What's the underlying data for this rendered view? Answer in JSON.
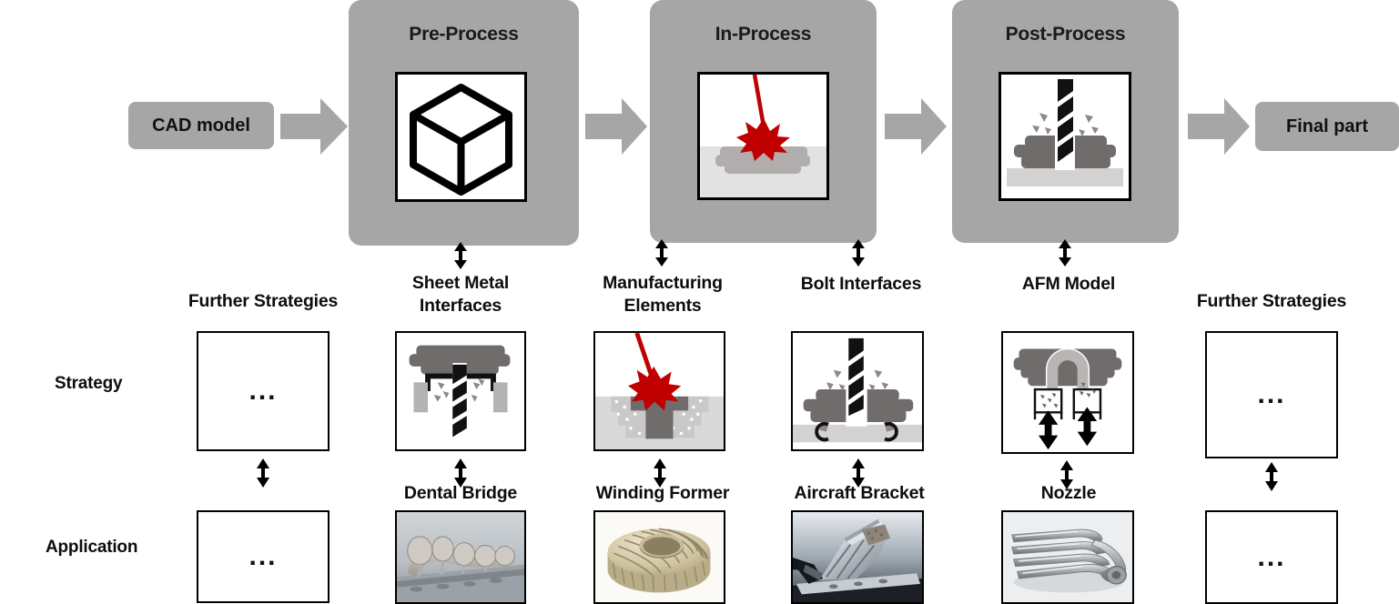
{
  "diagram": {
    "title": "Additive manufacturing process chain with strategies and applications",
    "colors": {
      "stage_gray": "#a6a6a6",
      "arrow_gray": "#a6a6a6",
      "laser_red": "#c00000",
      "part_dark_gray": "#706c6b",
      "powder_gray": "#d9d9d9",
      "black": "#000000"
    }
  },
  "chain": {
    "input_label": "CAD model",
    "output_label": "Final part",
    "stages": [
      {
        "title": "Pre-Process",
        "icon": "cube-icon"
      },
      {
        "title": "In-Process",
        "icon": "laser-melting-icon"
      },
      {
        "title": "Post-Process",
        "icon": "drilling-icon"
      }
    ],
    "arrows": [
      "arrow-right-icon",
      "arrow-right-icon",
      "arrow-right-icon",
      "arrow-right-icon"
    ]
  },
  "rows": {
    "strategy_label": "Strategy",
    "application_label": "Application"
  },
  "columns": [
    {
      "heading": "Further Strategies",
      "strategy_icon": "ellipsis-placeholder",
      "strategy_value": "...",
      "application_heading": "",
      "application_icon": "ellipsis-placeholder",
      "application_value": "...",
      "link_icon": "double-arrow-vertical-icon"
    },
    {
      "heading": "Sheet Metal\nInterfaces",
      "heading_line1": "Sheet Metal",
      "heading_line2": "Interfaces",
      "strategy_icon": "sheet-metal-drilling-icon",
      "application_heading": "Dental Bridge",
      "application_icon": "dental-bridge-photo",
      "link_icon": "double-arrow-vertical-icon"
    },
    {
      "heading": "Manufacturing\nElements",
      "heading_line1": "Manufacturing",
      "heading_line2": "Elements",
      "strategy_icon": "laser-melting-powder-icon",
      "application_heading": "Winding Former",
      "application_icon": "winding-former-photo",
      "link_icon": "double-arrow-vertical-icon"
    },
    {
      "heading": "Bolt Interfaces",
      "heading_line1": "Bolt Interfaces",
      "heading_line2": "",
      "strategy_icon": "bolt-drilling-icon",
      "application_heading": "Aircraft Bracket",
      "application_icon": "aircraft-bracket-photo",
      "link_icon": "double-arrow-vertical-icon"
    },
    {
      "heading": "AFM Model",
      "heading_line1": "AFM Model",
      "heading_line2": "",
      "strategy_icon": "abrasive-flow-machining-icon",
      "application_heading": "Nozzle",
      "application_icon": "nozzle-photo",
      "link_icon": "double-arrow-vertical-icon"
    },
    {
      "heading": "Further Strategies",
      "strategy_icon": "ellipsis-placeholder",
      "strategy_value": "...",
      "application_heading": "",
      "application_icon": "ellipsis-placeholder",
      "application_value": "...",
      "link_icon": "double-arrow-vertical-icon"
    }
  ]
}
